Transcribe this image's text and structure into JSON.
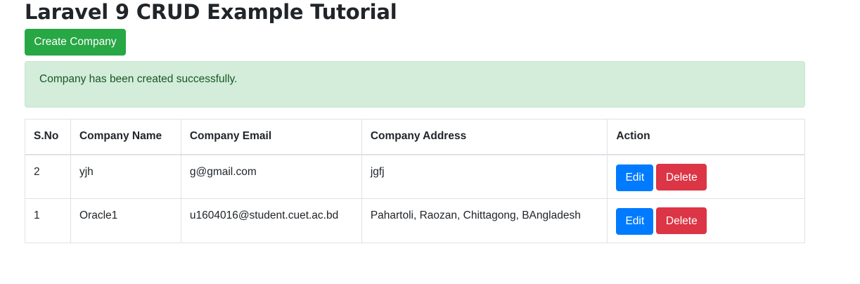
{
  "page": {
    "title": "Laravel 9 CRUD Example Tutorial"
  },
  "toolbar": {
    "create_label": "Create Company"
  },
  "alert": {
    "message": "Company has been created successfully."
  },
  "table": {
    "headers": [
      "S.No",
      "Company Name",
      "Company Email",
      "Company Address",
      "Action"
    ],
    "rows": [
      {
        "sno": "2",
        "name": "yjh",
        "email": "g@gmail.com",
        "address": "jgfj",
        "edit_label": "Edit",
        "delete_label": "Delete"
      },
      {
        "sno": "1",
        "name": "Oracle1",
        "email": "u1604016@student.cuet.ac.bd",
        "address": "Pahartoli, Raozan, Chittagong, BAngladesh",
        "edit_label": "Edit",
        "delete_label": "Delete"
      }
    ]
  },
  "colors": {
    "success": "#28a745",
    "primary": "#007bff",
    "danger": "#dc3545",
    "alert_bg": "#d4edda",
    "alert_text": "#155724"
  }
}
